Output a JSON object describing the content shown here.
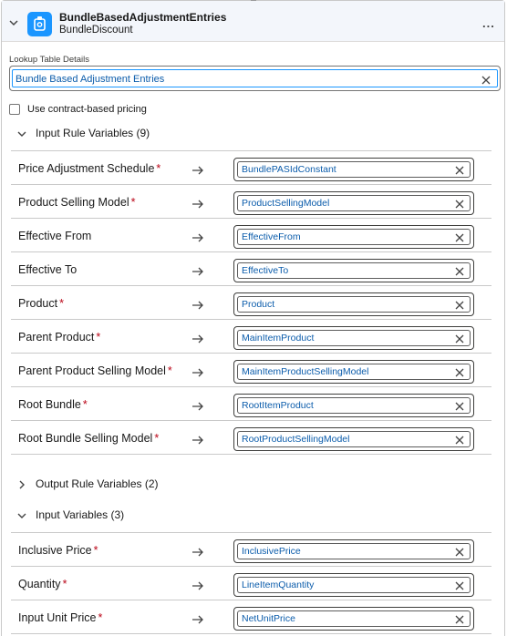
{
  "header": {
    "title": "BundleBasedAdjustmentEntries",
    "subtitle": "BundleDiscount",
    "more": "..."
  },
  "lookup": {
    "label": "Lookup Table Details",
    "value": "Bundle Based Adjustment Entries"
  },
  "contract_pricing": {
    "label": "Use contract-based pricing",
    "checked": false
  },
  "input_rule_variables": {
    "title": "Input Rule Variables (9)",
    "expanded": true,
    "rows": [
      {
        "label": "Price Adjustment Schedule",
        "required": "*",
        "value": "BundlePASIdConstant"
      },
      {
        "label": "Product Selling Model",
        "required": "*",
        "value": "ProductSellingModel"
      },
      {
        "label": "Effective From",
        "required": "",
        "value": "EffectiveFrom"
      },
      {
        "label": "Effective To",
        "required": "",
        "value": "EffectiveTo"
      },
      {
        "label": "Product",
        "required": "*",
        "value": "Product"
      },
      {
        "label": "Parent Product",
        "required": "*",
        "value": "MainItemProduct"
      },
      {
        "label": "Parent Product Selling Model",
        "required": "*",
        "value": "MainItemProductSellingModel"
      },
      {
        "label": "Root Bundle",
        "required": "*",
        "value": "RootItemProduct"
      },
      {
        "label": "Root Bundle Selling Model",
        "required": "*",
        "value": "RootProductSellingModel"
      }
    ]
  },
  "output_rule_variables": {
    "title": "Output Rule Variables (2)",
    "expanded": false
  },
  "input_variables": {
    "title": "Input Variables (3)",
    "expanded": true,
    "rows": [
      {
        "label": "Inclusive Price",
        "required": "*",
        "value": "InclusivePrice"
      },
      {
        "label": "Quantity",
        "required": "*",
        "value": "LineItemQuantity"
      },
      {
        "label": "Input Unit Price",
        "required": "*",
        "value": "NetUnitPrice"
      }
    ]
  },
  "colors": {
    "header_bg": "#f3f6fb",
    "brand_icon": "#1b96ff",
    "link_text": "#0b5cab",
    "required": "#ba0517"
  }
}
